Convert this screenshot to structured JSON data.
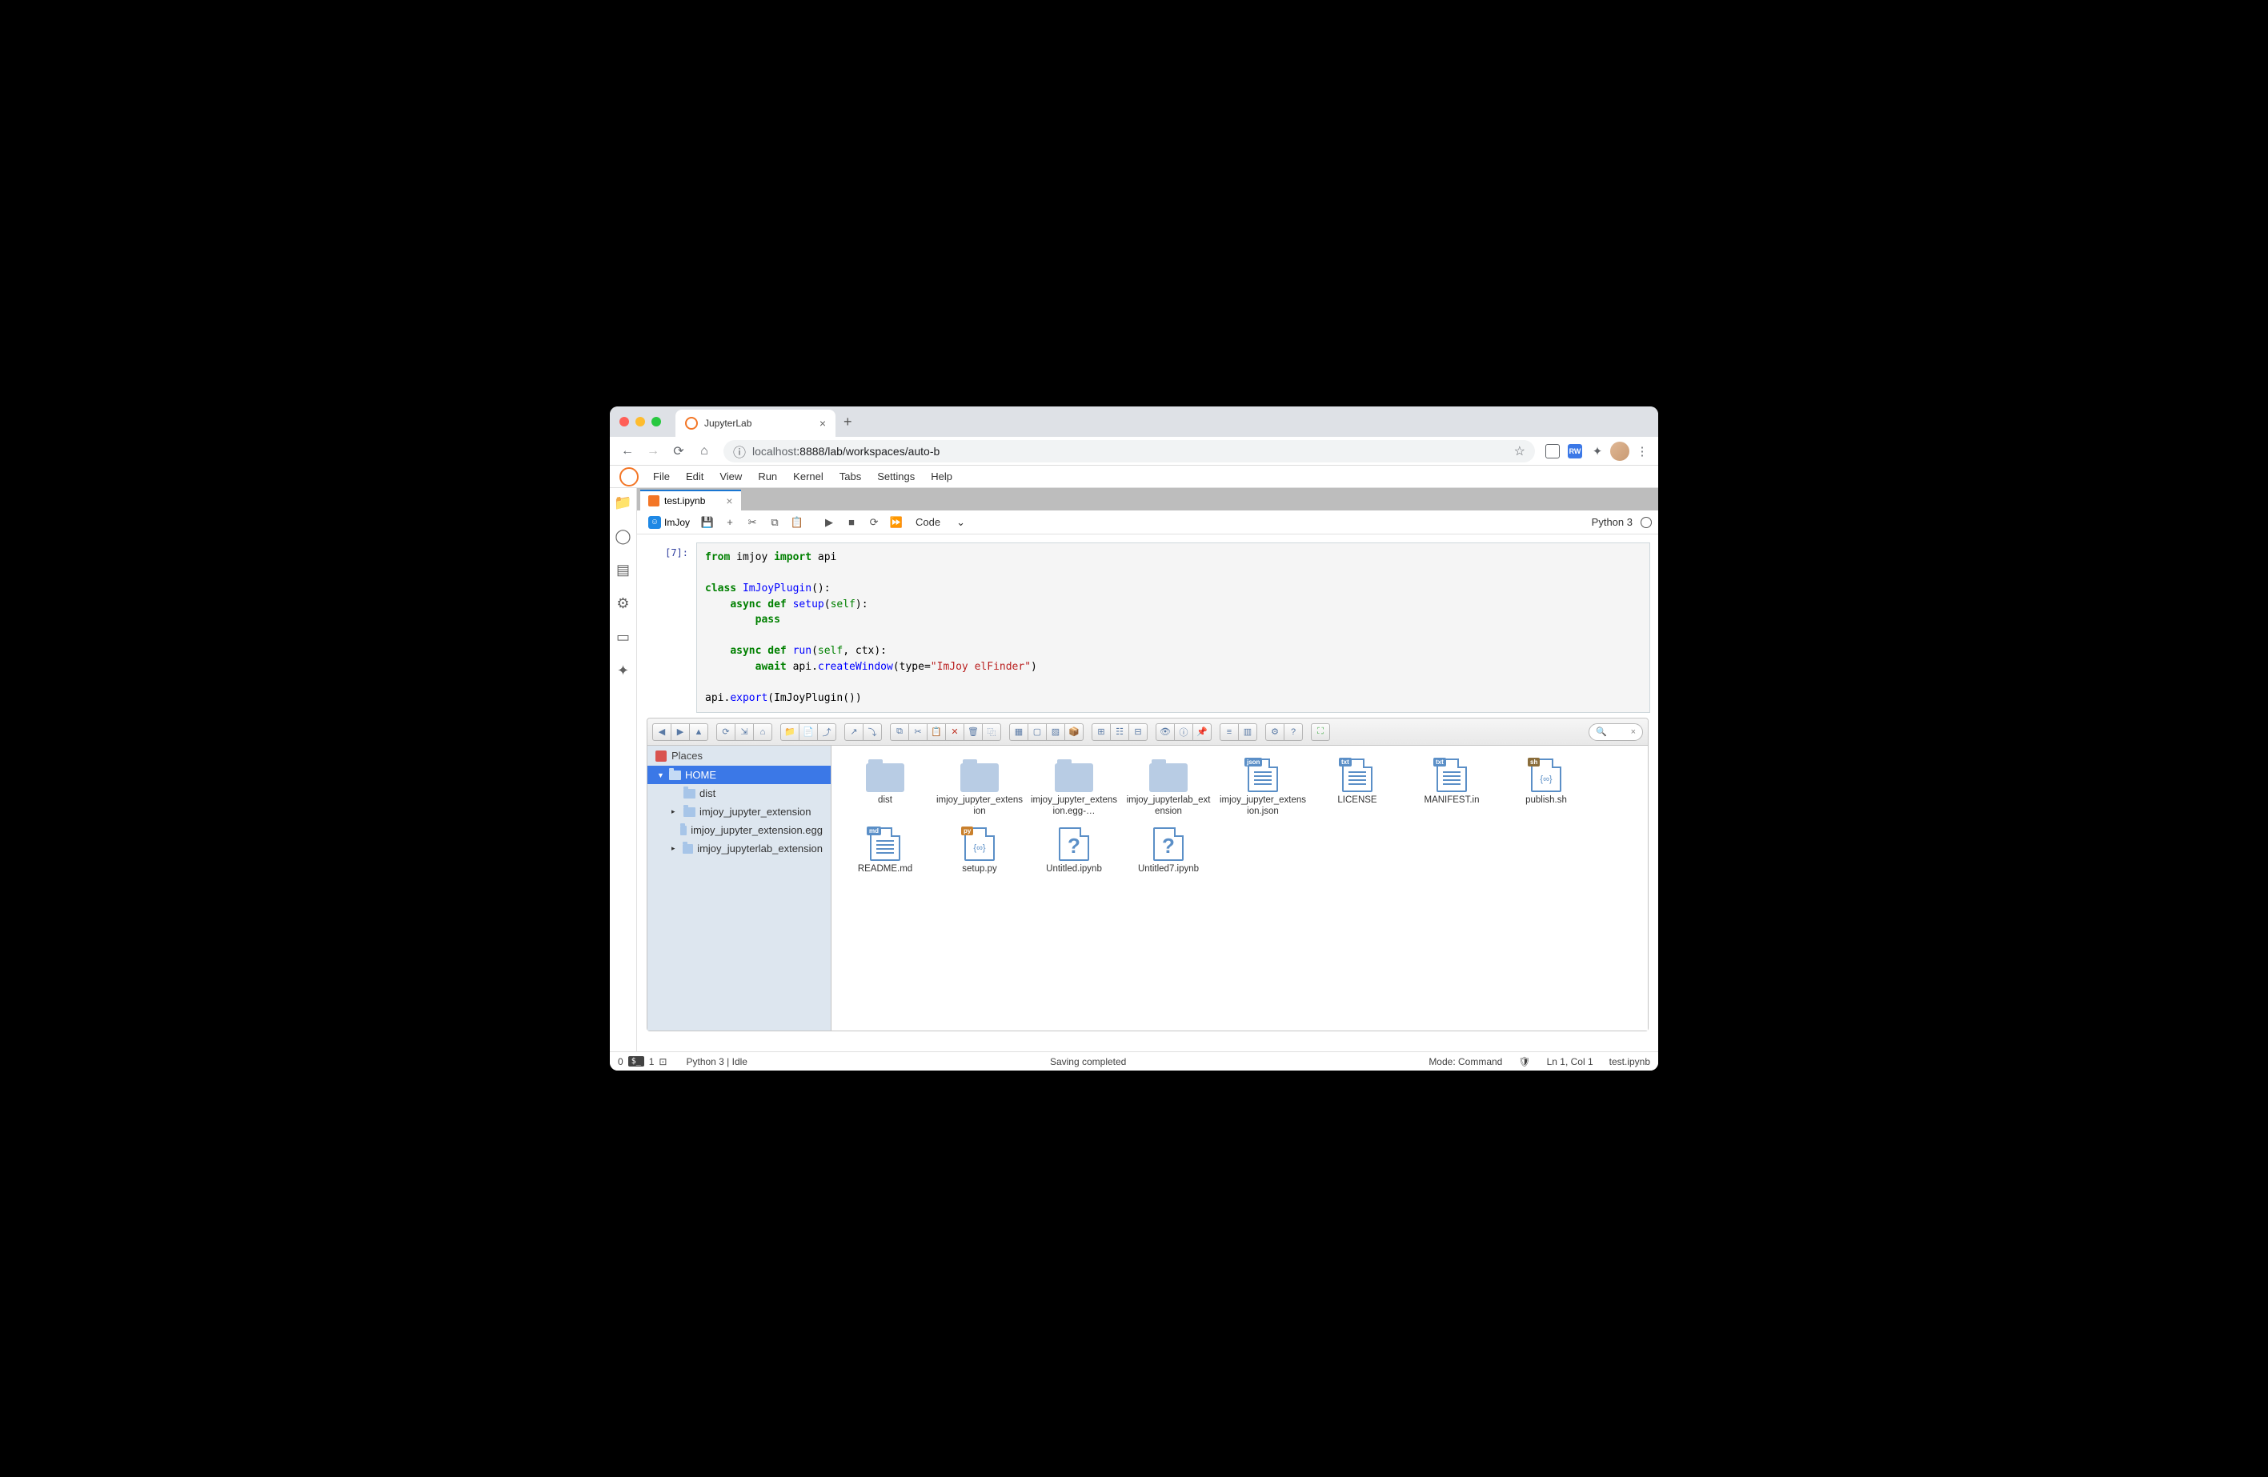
{
  "browser": {
    "tab_title": "JupyterLab",
    "url_host": "localhost",
    "url_port_path": ":8888/lab/workspaces/auto-b"
  },
  "menubar": [
    "File",
    "Edit",
    "View",
    "Run",
    "Kernel",
    "Tabs",
    "Settings",
    "Help"
  ],
  "sidebar_icons": [
    "folder",
    "circle",
    "running",
    "gear",
    "tabs",
    "puzzle"
  ],
  "document_tab": {
    "name": "test.ipynb"
  },
  "toolbar": {
    "imjoy_label": "ImJoy",
    "cell_type": "Code",
    "kernel": "Python 3"
  },
  "cell": {
    "prompt": "[7]:",
    "code_tokens": [
      [
        {
          "t": "from ",
          "c": "kw-green"
        },
        {
          "t": "imjoy ",
          "c": ""
        },
        {
          "t": "import ",
          "c": "kw-green"
        },
        {
          "t": "api",
          "c": ""
        }
      ],
      [],
      [
        {
          "t": "class ",
          "c": "kw-green"
        },
        {
          "t": "ImJoyPlugin",
          "c": "fn-blue"
        },
        {
          "t": "():",
          "c": ""
        }
      ],
      [
        {
          "t": "    ",
          "c": ""
        },
        {
          "t": "async def ",
          "c": "kw-green"
        },
        {
          "t": "setup",
          "c": "fn-blue"
        },
        {
          "t": "(",
          "c": ""
        },
        {
          "t": "self",
          "c": "builtin"
        },
        {
          "t": "):",
          "c": ""
        }
      ],
      [
        {
          "t": "        ",
          "c": ""
        },
        {
          "t": "pass",
          "c": "kw-green"
        }
      ],
      [],
      [
        {
          "t": "    ",
          "c": ""
        },
        {
          "t": "async def ",
          "c": "kw-green"
        },
        {
          "t": "run",
          "c": "fn-blue"
        },
        {
          "t": "(",
          "c": ""
        },
        {
          "t": "self",
          "c": "builtin"
        },
        {
          "t": ", ctx):",
          "c": ""
        }
      ],
      [
        {
          "t": "        ",
          "c": ""
        },
        {
          "t": "await ",
          "c": "kw-green"
        },
        {
          "t": "api",
          "c": ""
        },
        {
          "t": ".",
          "c": ""
        },
        {
          "t": "createWindow",
          "c": "fn-blue"
        },
        {
          "t": "(type",
          "c": ""
        },
        {
          "t": "=",
          "c": ""
        },
        {
          "t": "\"ImJoy elFinder\"",
          "c": "str-red"
        },
        {
          "t": ")",
          "c": ""
        }
      ],
      [],
      [
        {
          "t": "api",
          "c": ""
        },
        {
          "t": ".",
          "c": ""
        },
        {
          "t": "export",
          "c": "fn-blue"
        },
        {
          "t": "(ImJoyPlugin())",
          "c": ""
        }
      ]
    ]
  },
  "elfinder": {
    "places_label": "Places",
    "tree": [
      {
        "label": "HOME",
        "selected": true,
        "expanded": true,
        "depth": 0
      },
      {
        "label": "dist",
        "depth": 1
      },
      {
        "label": "imjoy_jupyter_extension",
        "depth": 1,
        "has_children": true
      },
      {
        "label": "imjoy_jupyter_extension.egg",
        "depth": 1
      },
      {
        "label": "imjoy_jupyterlab_extension",
        "depth": 1,
        "has_children": true
      }
    ],
    "files": [
      {
        "name": "dist",
        "type": "folder"
      },
      {
        "name": "imjoy_jupyter_extension",
        "type": "folder"
      },
      {
        "name": "imjoy_jupyter_extension.egg-…",
        "type": "folder"
      },
      {
        "name": "imjoy_jupyterlab_extension",
        "type": "folder"
      },
      {
        "name": "imjoy_jupyter_extension.json",
        "type": "doc",
        "badge": "json"
      },
      {
        "name": "LICENSE",
        "type": "doc",
        "badge": "txt"
      },
      {
        "name": "MANIFEST.in",
        "type": "doc",
        "badge": "txt"
      },
      {
        "name": "publish.sh",
        "type": "doc-xml",
        "badge": "sh"
      },
      {
        "name": "README.md",
        "type": "doc",
        "badge": "md"
      },
      {
        "name": "setup.py",
        "type": "doc-xml",
        "badge": "py"
      },
      {
        "name": "Untitled.ipynb",
        "type": "unknown"
      },
      {
        "name": "Untitled7.ipynb",
        "type": "unknown"
      }
    ]
  },
  "statusbar": {
    "terminals": "0",
    "kernels": "1",
    "kernel_status": "Python 3 | Idle",
    "save_status": "Saving completed",
    "mode": "Mode: Command",
    "cursor": "Ln 1, Col 1",
    "filename": "test.ipynb"
  }
}
